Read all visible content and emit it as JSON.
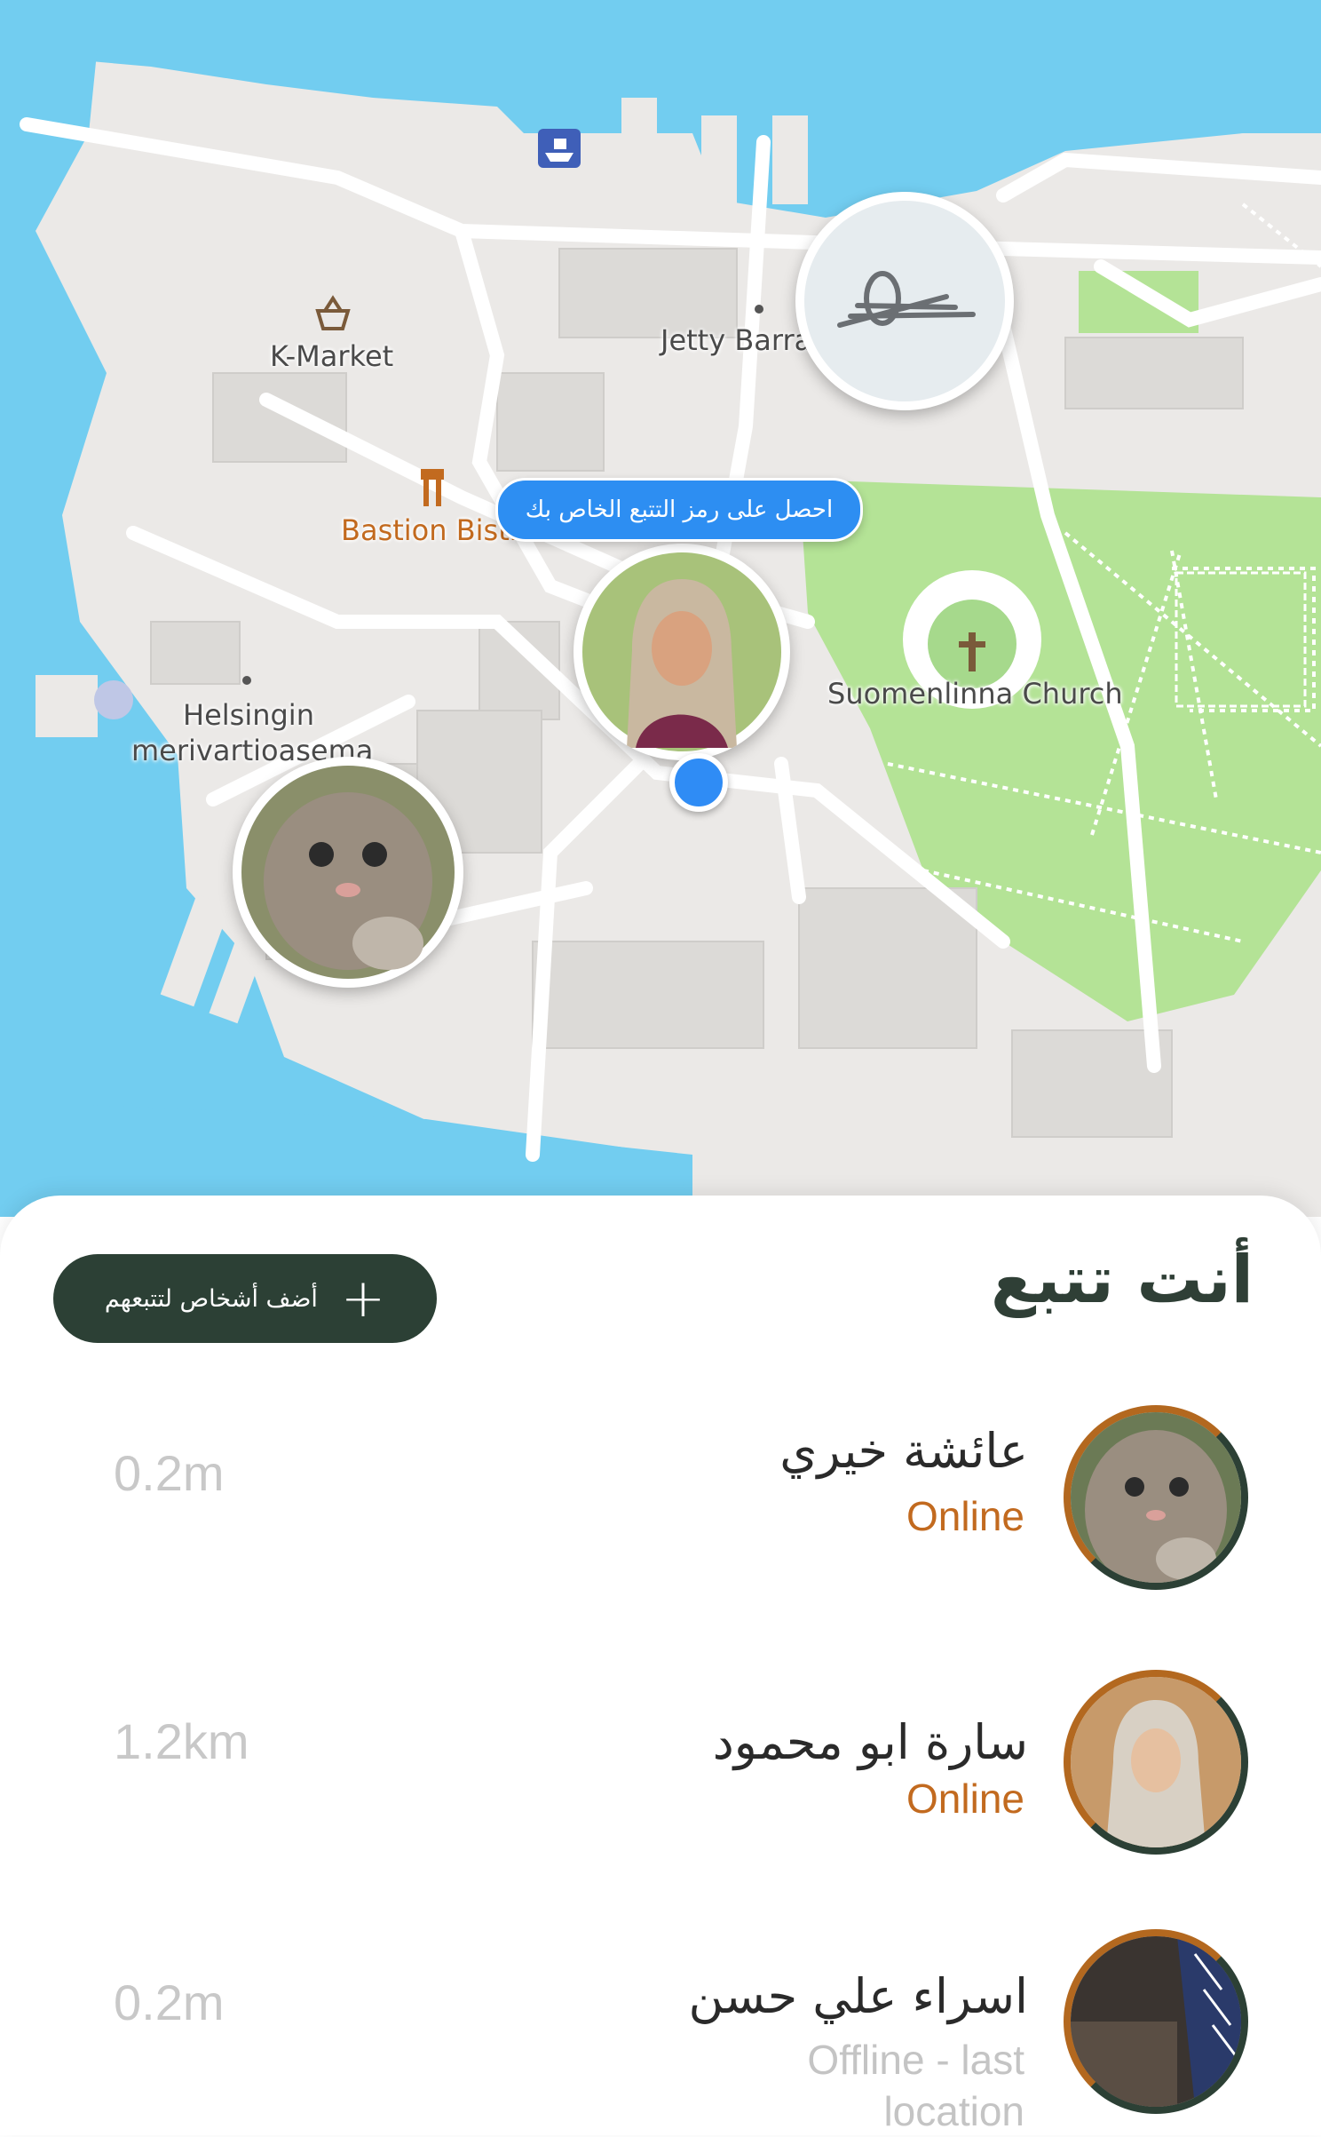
{
  "map": {
    "labels": {
      "k_market": "K-Market",
      "jetty": "Jetty Barra",
      "bastion": "Bastion Bistro",
      "church": "Suomenlinna Church",
      "helsingin_1": "Helsingin",
      "helsingin_2": "merivartioasema"
    },
    "tooltip": "احصل على رمز التتبع الخاص بك",
    "colors": {
      "water": "#72cdf0",
      "land": "#ebe9e7",
      "park": "#b4e396",
      "road": "#ffffff",
      "accent": "#2f8cf5"
    }
  },
  "sheet": {
    "title": "أنت تتبع",
    "add_button": "أضف أشخاص لتتبعهم",
    "people": [
      {
        "name": "عائشة خيري",
        "status": "Online",
        "distance": "0.2m"
      },
      {
        "name": "سارة ابو محمود",
        "status": "Online",
        "distance": "1.2km"
      },
      {
        "name": "اسراء علي حسن",
        "status": "Offline - last location",
        "distance": "0.2m"
      }
    ]
  }
}
